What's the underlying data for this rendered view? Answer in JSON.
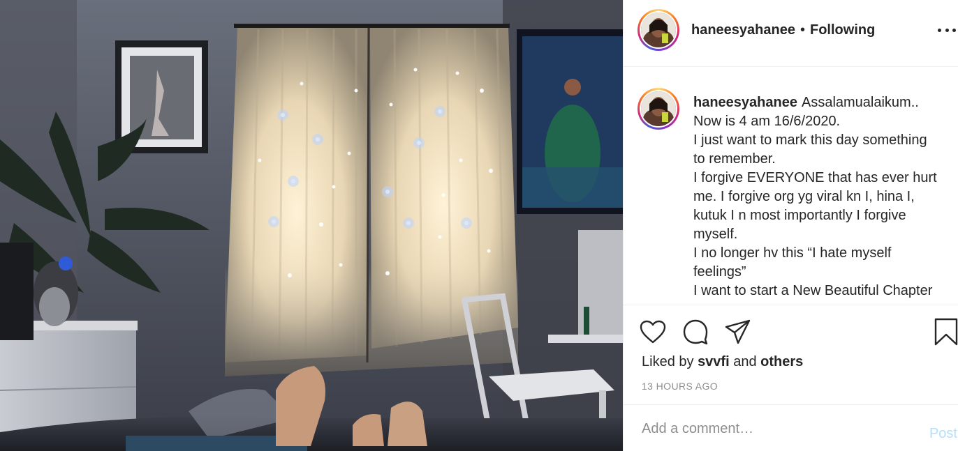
{
  "post": {
    "username": "haneesyahanee",
    "separator": "•",
    "follow_state": "Following",
    "caption": {
      "username": "haneesyahanee",
      "lines": [
        "Assalamualaikum..",
        "Now is 4 am 16/6/2020.",
        "I just want to mark this day something",
        "to remember.",
        "I forgive EVERYONE that has ever hurt",
        "me. I forgive org yg viral kn I, hina I,",
        "kutuk I n most importantly I forgive",
        "myself.",
        "I no longer hv this “I hate myself",
        "feelings”",
        "I want to start a New Beautiful Chapter"
      ]
    },
    "likes": {
      "prefix": "Liked by",
      "user": "svvfi",
      "conjunction": "and",
      "others": "others"
    },
    "timestamp": "13 HOURS AGO"
  },
  "comment": {
    "placeholder": "Add a comment…",
    "post_label": "Post"
  },
  "icons": {
    "like": "heart-icon",
    "comment": "comment-bubble-icon",
    "share": "paper-plane-icon",
    "save": "bookmark-icon",
    "more": "more-options-icon"
  },
  "colors": {
    "text": "#262626",
    "muted": "#8e8e8e",
    "post_button_disabled": "#b2dffc",
    "divider": "#efefef"
  }
}
